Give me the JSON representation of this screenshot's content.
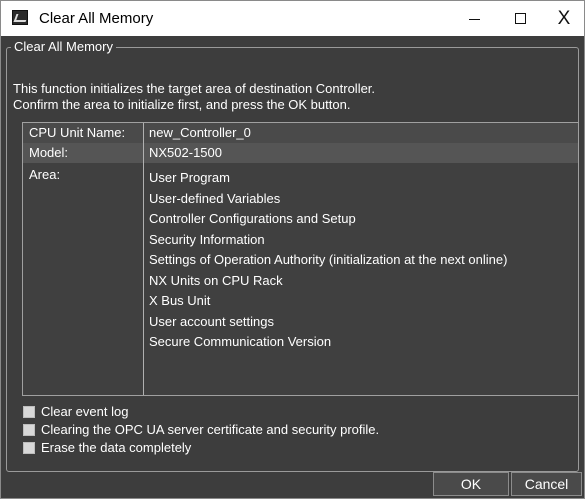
{
  "window": {
    "title": "Clear All Memory",
    "controls": {
      "minimize_icon": "minimize-icon",
      "maximize_icon": "maximize-icon",
      "close_label": "X"
    }
  },
  "group": {
    "title": "Clear All Memory",
    "description_line1": "This function initializes the target area of destination Controller.",
    "description_line2": "Confirm the area to initialize first, and press the OK button."
  },
  "info": {
    "cpu_label": "CPU Unit Name:",
    "cpu_value": "new_Controller_0",
    "model_label": "Model:",
    "model_value": "NX502-1500",
    "area_label": "Area:",
    "areas": [
      "User Program",
      "User-defined Variables",
      "Controller Configurations and Setup",
      "Security Information",
      "Settings of Operation Authority (initialization at the next online)",
      "NX Units on CPU Rack",
      "X Bus Unit",
      "User account settings",
      "Secure Communication Version"
    ]
  },
  "options": [
    {
      "label": "Clear event log",
      "checked": false
    },
    {
      "label": "Clearing the OPC UA server certificate and security profile.",
      "checked": false
    },
    {
      "label": "Erase the data completely",
      "checked": false
    }
  ],
  "buttons": {
    "ok": "OK",
    "cancel": "Cancel"
  }
}
